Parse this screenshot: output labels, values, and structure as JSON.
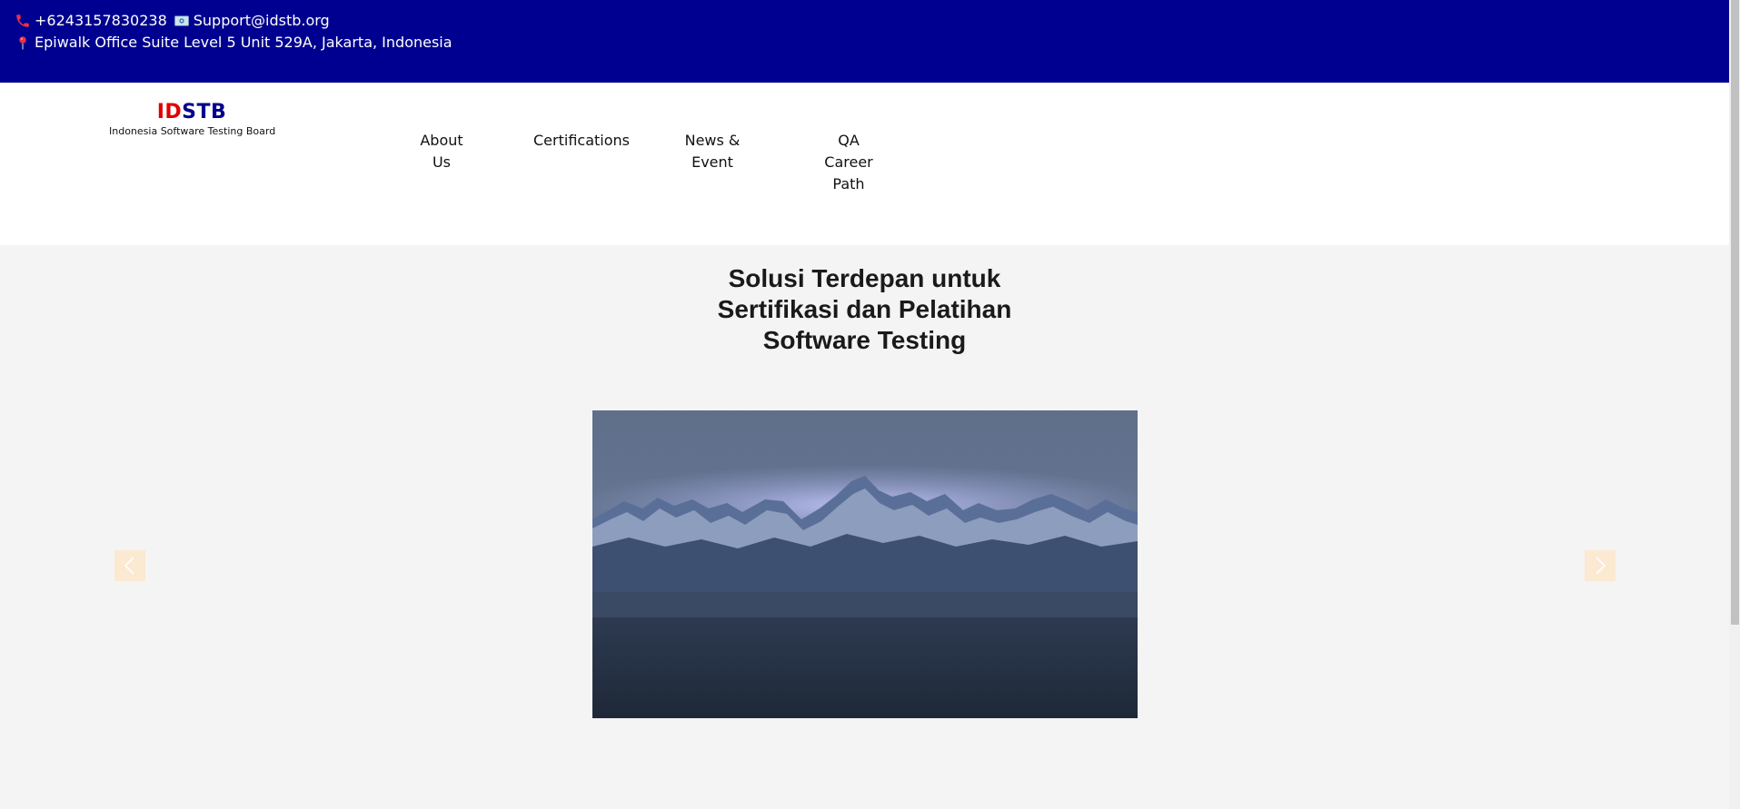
{
  "topbar": {
    "phone": "+6243157830238",
    "email": "Support@idstb.org",
    "address": "Epiwalk Office Suite Level 5 Unit 529A, Jakarta, Indonesia",
    "icons": [
      "phone-icon",
      "mail-icon",
      "pin-icon"
    ],
    "background": "#000090"
  },
  "logo": {
    "brand_id": "ID",
    "brand_stb": "STB",
    "tagline": "Indonesia Software Testing Board",
    "colors": {
      "id": "#e00000",
      "stb": "#00008b"
    }
  },
  "nav": {
    "items": [
      {
        "label": "About Us"
      },
      {
        "label": "Certifications"
      },
      {
        "label": "News & Event"
      },
      {
        "label": "QA Career Path"
      }
    ]
  },
  "hero": {
    "title": "Solusi Terdepan untuk Sertifikasi dan Pelatihan Software Testing",
    "prev_icon": "chevron-left-icon",
    "next_icon": "chevron-right-icon",
    "image": "mountain-landscape"
  }
}
